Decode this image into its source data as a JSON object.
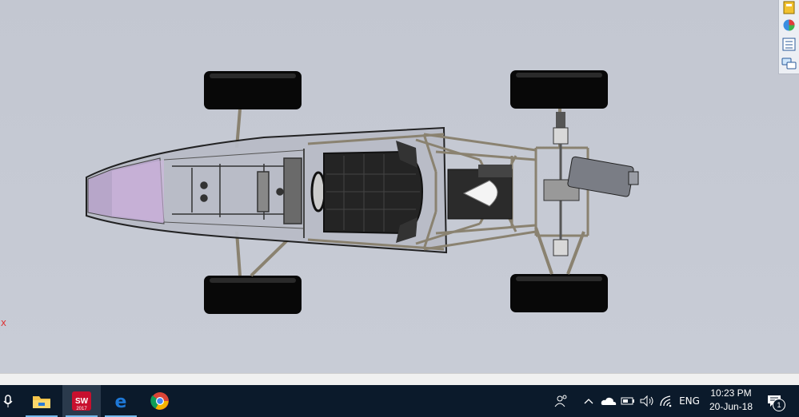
{
  "viewport": {
    "axis_label": "X"
  },
  "task_pane": {
    "icons": [
      "design-library-icon",
      "appearances-icon",
      "custom-properties-icon",
      "forum-icon"
    ]
  },
  "taskbar": {
    "apps": [
      {
        "name": "file-explorer",
        "icon": "folder-icon"
      },
      {
        "name": "solidworks",
        "icon": "solidworks-icon",
        "label": "2017"
      },
      {
        "name": "edge",
        "icon": "edge-icon"
      },
      {
        "name": "chrome",
        "icon": "chrome-icon"
      }
    ],
    "tray": {
      "language": "ENG",
      "time": "10:23 PM",
      "date": "20-Jun-18",
      "notification_count": "1"
    }
  },
  "colors": {
    "viewport_bg": "#c5c9d3",
    "taskbar_bg": "#0b1a2b",
    "solidworks_red": "#c8102e",
    "edge_blue": "#1e78d7"
  }
}
